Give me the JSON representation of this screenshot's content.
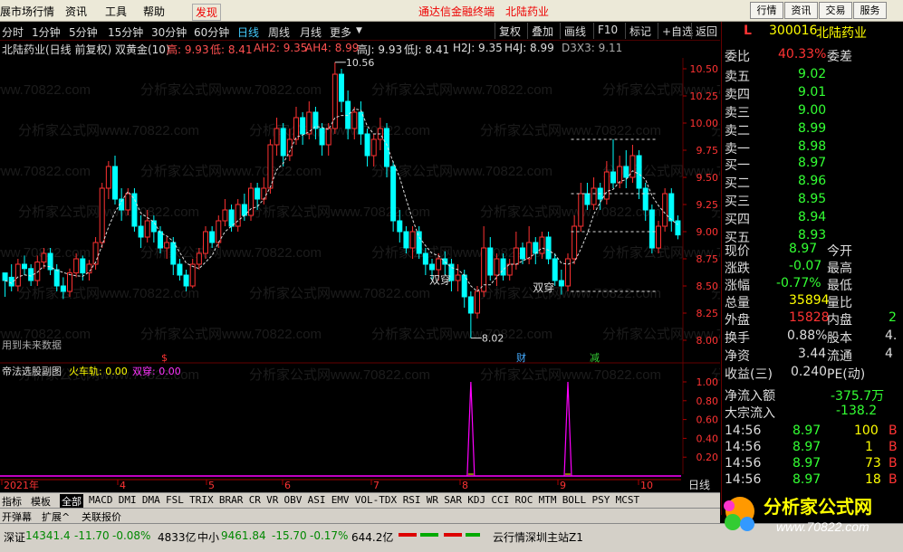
{
  "menubar": {
    "items": [
      "展市场行情",
      "资讯",
      "工具",
      "帮助",
      "发现"
    ],
    "center_left": "通达信金融终端",
    "center_right": "北陆药业",
    "buttons": [
      "行情",
      "资讯",
      "交易",
      "服务"
    ]
  },
  "toolbar": {
    "periods": [
      "分时",
      "1分钟",
      "5分钟",
      "15分钟",
      "30分钟",
      "60分钟",
      "日线",
      "周线",
      "月线",
      "更多"
    ],
    "active_period": "日线",
    "more_arrow": "▼",
    "buttons": [
      "复权",
      "叠加",
      "画线",
      "F10",
      "标记",
      "+自选",
      "返回"
    ]
  },
  "infoline": {
    "title": "北陆药业(日线 前复权) 双黄金(10)",
    "high_label": "高: 9.93",
    "low_label": "低: 8.41",
    "ah2": "AH2: 9.35",
    "ah4": "AH4: 8.99",
    "highj": "高J: 9.93",
    "lowj": "低J: 8.41",
    "h2j": "H2J: 9.35",
    "h4j": "H4J: 8.99",
    "d3x3": "D3X3: 9.11"
  },
  "chart_data": {
    "type": "candlestick",
    "title": "北陆药业(日线 前复权) 双黄金(10)",
    "y_ticks": [
      "10.50",
      "10.25",
      "10.00",
      "9.75",
      "9.50",
      "9.25",
      "9.00",
      "8.75",
      "8.50",
      "8.25",
      "8.00"
    ],
    "ylim": [
      7.95,
      10.6
    ],
    "annotations": [
      {
        "text": "10.56",
        "label": "high"
      },
      {
        "text": "8.02",
        "label": "low"
      },
      {
        "text": "双穿",
        "label": "signal"
      },
      {
        "text": "双穿",
        "label": "signal"
      }
    ],
    "resistance_levels": [
      9.85,
      9.35,
      9.0,
      8.45
    ],
    "candles_ohlc": [
      [
        8.62,
        8.55,
        8.58,
        8.4
      ],
      [
        8.58,
        8.5,
        8.7,
        8.45
      ],
      [
        8.5,
        8.7,
        8.75,
        8.45
      ],
      [
        8.7,
        8.66,
        8.78,
        8.6
      ],
      [
        8.66,
        8.55,
        8.7,
        8.5
      ],
      [
        8.55,
        8.72,
        8.78,
        8.5
      ],
      [
        8.72,
        8.8,
        8.85,
        8.66
      ],
      [
        8.8,
        8.65,
        8.85,
        8.6
      ],
      [
        8.65,
        8.5,
        8.7,
        8.45
      ],
      [
        8.5,
        8.45,
        8.58,
        8.38
      ],
      [
        8.45,
        8.62,
        8.66,
        8.4
      ],
      [
        8.62,
        8.75,
        8.8,
        8.58
      ],
      [
        8.75,
        8.62,
        8.78,
        8.55
      ],
      [
        8.62,
        8.7,
        8.74,
        8.55
      ],
      [
        8.7,
        8.9,
        8.95,
        8.65
      ],
      [
        8.9,
        9.4,
        9.45,
        8.85
      ],
      [
        9.4,
        9.6,
        9.65,
        9.3
      ],
      [
        9.6,
        9.3,
        9.7,
        9.25
      ],
      [
        9.3,
        9.2,
        9.4,
        9.1
      ],
      [
        9.2,
        9.35,
        9.4,
        9.15
      ],
      [
        9.35,
        9.05,
        9.4,
        9.0
      ],
      [
        9.05,
        8.95,
        9.15,
        8.85
      ],
      [
        8.95,
        9.1,
        9.2,
        8.9
      ],
      [
        9.1,
        9.0,
        9.15,
        8.9
      ],
      [
        9.0,
        8.85,
        9.05,
        8.8
      ],
      [
        8.85,
        8.9,
        8.95,
        8.75
      ],
      [
        8.9,
        8.7,
        8.95,
        8.6
      ],
      [
        8.7,
        8.6,
        8.75,
        8.55
      ],
      [
        8.6,
        8.5,
        8.65,
        8.45
      ],
      [
        8.5,
        8.7,
        8.75,
        8.48
      ],
      [
        8.7,
        8.8,
        8.85,
        8.65
      ],
      [
        8.8,
        9.0,
        9.05,
        8.75
      ],
      [
        9.0,
        8.9,
        9.05,
        8.85
      ],
      [
        8.9,
        9.1,
        9.15,
        8.85
      ],
      [
        9.1,
        9.2,
        9.3,
        9.05
      ],
      [
        9.2,
        9.05,
        9.25,
        9.0
      ],
      [
        9.05,
        9.25,
        9.3,
        9.0
      ],
      [
        9.25,
        9.15,
        9.35,
        9.1
      ],
      [
        9.15,
        9.4,
        9.45,
        9.1
      ],
      [
        9.4,
        9.3,
        9.45,
        9.2
      ],
      [
        9.3,
        9.4,
        9.5,
        9.25
      ],
      [
        9.4,
        9.8,
        9.85,
        9.35
      ],
      [
        9.8,
        9.95,
        10.05,
        9.7
      ],
      [
        9.95,
        9.7,
        10.0,
        9.6
      ],
      [
        9.7,
        9.85,
        9.95,
        9.65
      ],
      [
        9.85,
        10.05,
        10.15,
        9.8
      ],
      [
        10.05,
        9.9,
        10.1,
        9.8
      ],
      [
        9.9,
        10.1,
        10.2,
        9.85
      ],
      [
        10.1,
        9.95,
        10.15,
        9.85
      ],
      [
        9.95,
        9.8,
        10.0,
        9.7
      ],
      [
        9.8,
        9.95,
        10.0,
        9.7
      ],
      [
        9.95,
        10.45,
        10.56,
        9.9
      ],
      [
        10.45,
        10.2,
        10.5,
        10.1
      ],
      [
        10.2,
        9.95,
        10.3,
        9.85
      ],
      [
        9.95,
        10.1,
        10.15,
        9.85
      ],
      [
        10.1,
        9.9,
        10.2,
        9.8
      ],
      [
        9.9,
        9.7,
        9.95,
        9.6
      ],
      [
        9.7,
        9.85,
        9.9,
        9.6
      ],
      [
        9.85,
        9.95,
        10.05,
        9.75
      ],
      [
        9.95,
        9.6,
        10.0,
        9.5
      ],
      [
        9.6,
        9.1,
        9.65,
        9.0
      ],
      [
        9.1,
        9.0,
        9.2,
        8.9
      ],
      [
        9.0,
        8.85,
        9.05,
        8.8
      ],
      [
        8.85,
        9.0,
        9.05,
        8.75
      ],
      [
        9.0,
        8.8,
        9.05,
        8.75
      ],
      [
        8.8,
        8.7,
        8.85,
        8.6
      ],
      [
        8.7,
        8.65,
        8.75,
        8.55
      ],
      [
        8.65,
        8.75,
        8.8,
        8.55
      ],
      [
        8.75,
        8.7,
        8.82,
        8.6
      ],
      [
        8.7,
        8.55,
        8.75,
        8.45
      ],
      [
        8.55,
        8.6,
        8.7,
        8.45
      ],
      [
        8.6,
        8.4,
        8.65,
        8.3
      ],
      [
        8.4,
        8.25,
        8.45,
        8.02
      ],
      [
        8.25,
        8.45,
        8.5,
        8.2
      ],
      [
        8.45,
        8.85,
        9.05,
        8.4
      ],
      [
        8.85,
        8.6,
        8.95,
        8.55
      ],
      [
        8.6,
        8.75,
        8.8,
        8.5
      ],
      [
        8.75,
        8.6,
        8.8,
        8.55
      ],
      [
        8.6,
        8.7,
        8.75,
        8.55
      ],
      [
        8.7,
        8.85,
        9.0,
        8.65
      ],
      [
        8.85,
        8.75,
        8.9,
        8.7
      ],
      [
        8.75,
        8.9,
        9.05,
        8.7
      ],
      [
        8.9,
        8.8,
        8.95,
        8.7
      ],
      [
        8.8,
        8.95,
        9.0,
        8.75
      ],
      [
        8.95,
        8.75,
        9.0,
        8.7
      ],
      [
        8.75,
        8.55,
        8.8,
        8.5
      ],
      [
        8.55,
        8.5,
        8.65,
        8.42
      ],
      [
        8.5,
        8.75,
        8.8,
        8.45
      ],
      [
        8.75,
        9.05,
        9.15,
        8.7
      ],
      [
        9.05,
        9.35,
        9.45,
        9.0
      ],
      [
        9.35,
        9.25,
        9.45,
        9.2
      ],
      [
        9.25,
        9.4,
        9.5,
        9.2
      ],
      [
        9.4,
        9.3,
        9.45,
        9.2
      ],
      [
        9.3,
        9.55,
        9.65,
        9.25
      ],
      [
        9.55,
        9.45,
        9.85,
        9.4
      ],
      [
        9.45,
        9.6,
        9.7,
        9.4
      ],
      [
        9.6,
        9.5,
        9.75,
        9.4
      ],
      [
        9.5,
        9.7,
        9.8,
        9.45
      ],
      [
        9.7,
        9.4,
        9.75,
        9.3
      ],
      [
        9.4,
        9.2,
        9.45,
        9.1
      ],
      [
        9.2,
        8.85,
        9.25,
        8.8
      ],
      [
        8.85,
        9.05,
        9.1,
        8.8
      ],
      [
        9.05,
        9.35,
        9.4,
        9.0
      ],
      [
        9.35,
        9.1,
        9.4,
        9.0
      ],
      [
        9.1,
        8.97,
        9.15,
        8.93
      ]
    ],
    "sub_title": "帝法选股副图",
    "sub_series": [
      {
        "name": "火车轨",
        "value": "0.00"
      },
      {
        "name": "双穿",
        "value": "0.00"
      }
    ],
    "sub_y_ticks": [
      "1.00",
      "0.80",
      "0.60",
      "0.40",
      "0.20"
    ],
    "sub_spikes_at": [
      72,
      87
    ],
    "x_labels": [
      "2021年",
      "4",
      "5",
      "6",
      "7",
      "8",
      "9",
      "10"
    ],
    "markers": [
      "$",
      "财",
      "减"
    ],
    "note": "用到未来数据",
    "period_label": "日线"
  },
  "quote": {
    "type_letter": "L",
    "code": "300016",
    "name": "北陆药业",
    "weibi_label": "委比",
    "weibi_value": "40.33%",
    "weicha_label": "委差",
    "asks": [
      {
        "label": "卖五",
        "price": "9.02"
      },
      {
        "label": "卖四",
        "price": "9.01"
      },
      {
        "label": "卖三",
        "price": "9.00"
      },
      {
        "label": "卖二",
        "price": "8.99"
      },
      {
        "label": "卖一",
        "price": "8.98"
      }
    ],
    "bids": [
      {
        "label": "买一",
        "price": "8.97"
      },
      {
        "label": "买二",
        "price": "8.96"
      },
      {
        "label": "买三",
        "price": "8.95"
      },
      {
        "label": "买四",
        "price": "8.94"
      },
      {
        "label": "买五",
        "price": "8.93"
      }
    ],
    "stats": [
      {
        "label": "现价",
        "value": "8.97",
        "label2": "今开",
        "color": "#3f3"
      },
      {
        "label": "涨跌",
        "value": "-0.07",
        "label2": "最高",
        "color": "#3f3"
      },
      {
        "label": "涨幅",
        "value": "-0.77%",
        "label2": "最低",
        "color": "#3f3"
      },
      {
        "label": "总量",
        "value": "35894",
        "label2": "量比",
        "color": "#ff0"
      },
      {
        "label": "外盘",
        "value": "15828",
        "label2": "内盘",
        "color": "#f33",
        "extra": "2"
      }
    ],
    "turnover": {
      "label": "换手",
      "value": "0.88%",
      "label2": "股本",
      "extra": "4."
    },
    "net_asset": {
      "label": "净资",
      "value": "3.44",
      "label2": "流通",
      "extra": "4"
    },
    "eps": {
      "label": "收益(三)",
      "value": "0.240",
      "label2": "PE(动)"
    },
    "net_inflow": {
      "label": "净流入额",
      "value": "-375.7万"
    },
    "block_inflow": {
      "label": "大宗流入",
      "value": "-138.2"
    },
    "ticks": [
      {
        "time": "14:56",
        "price": "8.97",
        "vol": "100",
        "side": "B"
      },
      {
        "time": "14:56",
        "price": "8.97",
        "vol": "1",
        "side": "B"
      },
      {
        "time": "14:56",
        "price": "8.97",
        "vol": "73",
        "side": "B"
      },
      {
        "time": "14:56",
        "price": "8.97",
        "vol": "18",
        "side": "B"
      }
    ]
  },
  "bottomtabs": [
    "指标",
    "模板",
    "全部",
    "MACD",
    "DMI",
    "DMA",
    "FSL",
    "TRIX",
    "BRAR",
    "CR",
    "VR",
    "OBV",
    "ASI",
    "EMV",
    "VOL-TDX",
    "RSI",
    "WR",
    "SAR",
    "KDJ",
    "CCI",
    "ROC",
    "MTM",
    "BOLL",
    "PSY",
    "MCST"
  ],
  "bottomtabs_active": "全部",
  "bottom2": [
    "开弹幕",
    "扩展^",
    "关联报价"
  ],
  "statusbar": {
    "sz_label": "深证",
    "sz_value": "14341.4",
    "sz_change": "-11.70",
    "sz_pct": "-0.08%",
    "sz_amount": "4833亿",
    "zx_label": "中小",
    "zx_value": "9461.84",
    "zx_change": "-15.70",
    "zx_pct": "-0.17%",
    "zx_amount": "644.2亿",
    "server": "云行情深圳主站Z1"
  },
  "watermark": "分析家公式网www.70822.com",
  "logo": {
    "text": "分析家公式网",
    "url": "www.70822.com"
  },
  "colors": {
    "up": "#ff3232",
    "down": "#00ffff",
    "bg": "#000000",
    "grid": "#600000",
    "sub_line": "#ff00ff"
  }
}
